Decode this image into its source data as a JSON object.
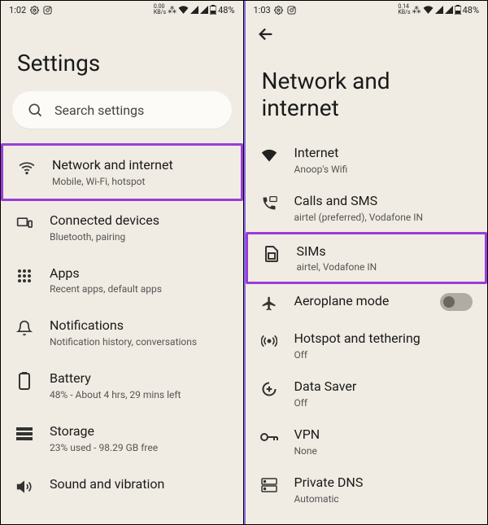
{
  "left": {
    "status": {
      "time": "1:02",
      "net_speed": "0.00",
      "net_unit": "KB/s",
      "battery": "48%"
    },
    "title": "Settings",
    "search_placeholder": "Search settings",
    "items": [
      {
        "title": "Network and internet",
        "sub": "Mobile, Wi-Fi, hotspot",
        "highlight": true
      },
      {
        "title": "Connected devices",
        "sub": "Bluetooth, pairing"
      },
      {
        "title": "Apps",
        "sub": "Recent apps, default apps"
      },
      {
        "title": "Notifications",
        "sub": "Notification history, conversations"
      },
      {
        "title": "Battery",
        "sub": "48% - About 4 hrs, 29 mins left"
      },
      {
        "title": "Storage",
        "sub": "23% used - 98.29 GB free"
      },
      {
        "title": "Sound and vibration",
        "sub": ""
      }
    ]
  },
  "right": {
    "status": {
      "time": "1:03",
      "net_speed": "0.14",
      "net_unit": "KB/s",
      "battery": "48%"
    },
    "title": "Network and internet",
    "items": [
      {
        "title": "Internet",
        "sub": "Anoop's Wifi"
      },
      {
        "title": "Calls and SMS",
        "sub": "airtel (preferred), Vodafone IN"
      },
      {
        "title": "SIMs",
        "sub": "airtel, Vodafone IN",
        "highlight": true
      },
      {
        "title": "Aeroplane mode",
        "toggle": true
      },
      {
        "title": "Hotspot and tethering",
        "sub": "Off"
      },
      {
        "title": "Data Saver",
        "sub": "Off"
      },
      {
        "title": "VPN",
        "sub": "None"
      },
      {
        "title": "Private DNS",
        "sub": "Automatic"
      }
    ]
  }
}
